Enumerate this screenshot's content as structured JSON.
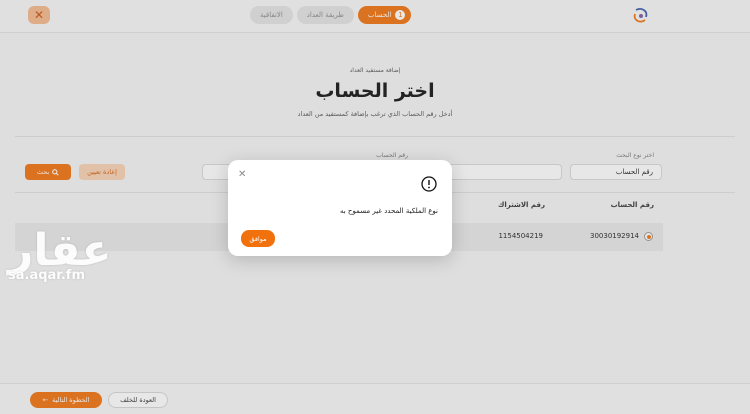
{
  "header": {
    "close_symbol": "✕",
    "steps": [
      {
        "label": "الحساب",
        "number": "1",
        "active": true
      },
      {
        "label": "طريقة العداد",
        "active": false
      },
      {
        "label": "الاتفاقية",
        "active": false
      }
    ],
    "logo_icon": "logo-swirl-icon"
  },
  "page": {
    "subtitle_small": "إضافة مستفيد العداد",
    "title": "اختر الحساب",
    "description": "أدخل رقم الحساب الذي ترغب بإضافة كمستفيد من العداد"
  },
  "filters": {
    "search_type_label": "اختر نوع البحث",
    "search_type_value": "رقم الحساب",
    "account_number_label": "رقم الحساب",
    "account_number_value": "",
    "reset_label": "إعادة تعيين",
    "search_label": "بحث"
  },
  "table": {
    "headers": {
      "account": "رقم الحساب",
      "subscription": "رقم الاشتراك"
    },
    "rows": [
      {
        "account": "30030192914",
        "subscription": "1154504219",
        "selected": true
      }
    ]
  },
  "footer": {
    "next_label": "الخطوة التالية",
    "back_label": "العودة للخلف"
  },
  "watermark": {
    "arabic": "عقار",
    "url": "sa.aqar.fm"
  },
  "modal": {
    "close_symbol": "✕",
    "message": "نوع الملكية المحدد غير مسموح به",
    "ok_label": "موافق"
  },
  "colors": {
    "accent": "#f1710d",
    "accent_light": "#f8d2b4"
  }
}
